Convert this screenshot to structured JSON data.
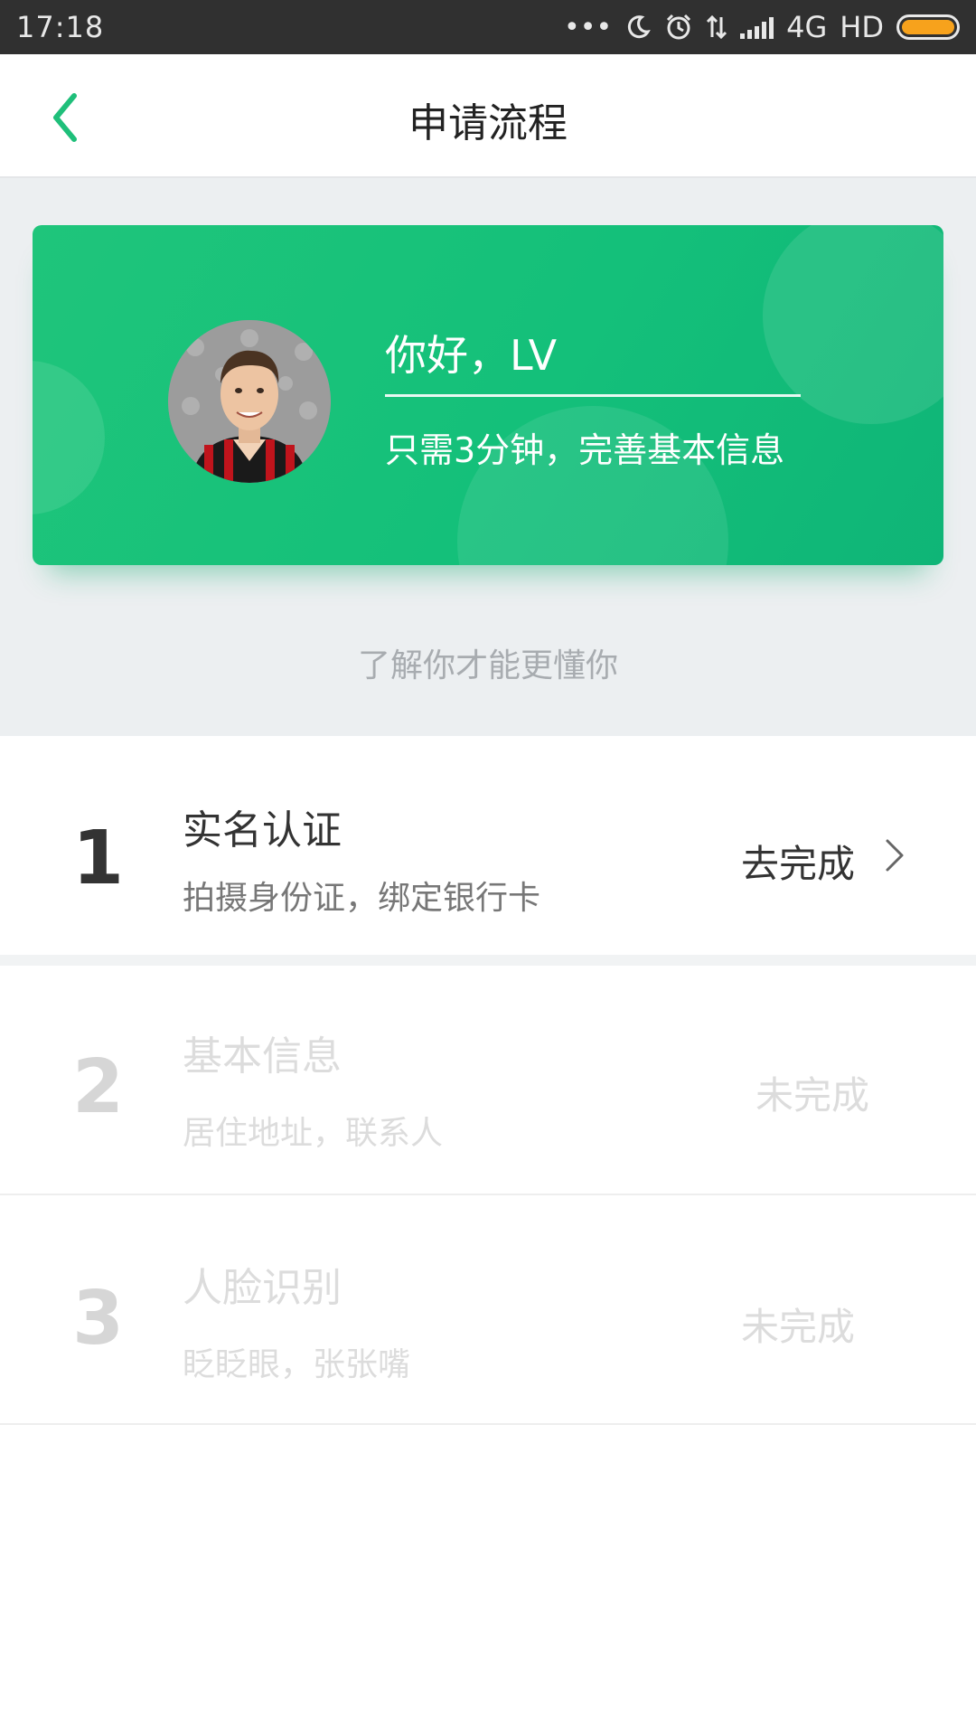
{
  "status_bar": {
    "time": "17:18",
    "network": "4G",
    "hd": "HD",
    "icons": [
      "dots-icon",
      "moon-icon",
      "alarm-icon",
      "data-arrows-icon",
      "signal-icon",
      "battery-icon"
    ],
    "battery_color": "#f7a21c"
  },
  "header": {
    "title": "申请流程",
    "back_icon": "chevron-left-icon",
    "accent": "#1fbf7a"
  },
  "card": {
    "greeting": "你好，LV",
    "subtitle": "只需3分钟，完善基本信息",
    "avatar": "user-avatar-photo",
    "color": "#14c07a"
  },
  "tagline": "了解你才能更懂你",
  "steps": [
    {
      "number": "1",
      "title": "实名认证",
      "desc": "拍摄身份证，绑定银行卡",
      "action": "去完成",
      "active": true
    },
    {
      "number": "2",
      "title": "基本信息",
      "desc": "居住地址，联系人",
      "action": "未完成",
      "active": false
    },
    {
      "number": "3",
      "title": "人脸识别",
      "desc": "眨眨眼，张张嘴",
      "action": "未完成",
      "active": false
    }
  ]
}
